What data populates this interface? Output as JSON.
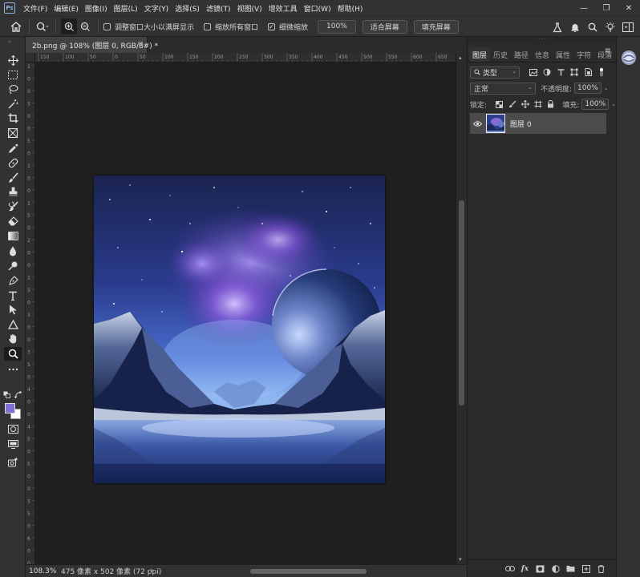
{
  "menubar": {
    "logo": "Ps",
    "items": [
      "文件(F)",
      "编辑(E)",
      "图像(I)",
      "图层(L)",
      "文字(Y)",
      "选择(S)",
      "滤镜(T)",
      "视图(V)",
      "增效工具",
      "窗口(W)",
      "帮助(H)"
    ],
    "window_controls": [
      "—",
      "❐",
      "✕"
    ]
  },
  "options": {
    "resize_windows_label": "调整窗口大小以满屏显示",
    "resize_windows_checked": false,
    "zoom_all_label": "缩放所有窗口",
    "zoom_all_checked": false,
    "scrubby_zoom_label": "细微缩放",
    "scrubby_zoom_checked": true,
    "zoom_value": "100%",
    "fit_screen_label": "适合屏幕",
    "fill_screen_label": "填充屏幕"
  },
  "document": {
    "tab_title": "2b.png @ 108% (图层 0, RGB/8#) *",
    "close_glyph": "×"
  },
  "status": {
    "zoom": "108.3%",
    "info": "475 像素 x 502 像素 (72 ppi)",
    "info_arrow": "›"
  },
  "panel": {
    "tabs": [
      "图层",
      "历史",
      "路径",
      "信息",
      "属性",
      "字符",
      "段落"
    ],
    "active_tab": "图层",
    "menu_glyph": "≡",
    "filter_kind": "类型",
    "blend_mode": "正常",
    "opacity_label": "不透明度:",
    "opacity_value": "100%",
    "lock_label": "锁定:",
    "fill_label": "填充:",
    "fill_value": "100%",
    "layers": [
      {
        "name": "图层 0",
        "visible": true
      }
    ]
  },
  "ruler": {
    "top_ticks": [
      "150",
      "100",
      "50",
      "0",
      "50",
      "100",
      "150",
      "200",
      "250",
      "300",
      "350",
      "400",
      "450",
      "500",
      "550",
      "600",
      "650"
    ],
    "left_ticks": [
      "1",
      "0",
      "0",
      "5",
      "0",
      "0",
      "5",
      "0",
      "1",
      "0",
      "0",
      "1",
      "5",
      "0",
      "2",
      "0",
      "0",
      "2",
      "5",
      "0",
      "3",
      "0",
      "0",
      "3",
      "5",
      "0",
      "4",
      "0",
      "0",
      "4",
      "5",
      "0",
      "5",
      "0",
      "0",
      "5",
      "5",
      "0",
      "6",
      "0",
      "0"
    ]
  },
  "colors": {
    "foreground": "#7c6fd6",
    "background": "#ffffff",
    "accent": "#8db3e2"
  }
}
